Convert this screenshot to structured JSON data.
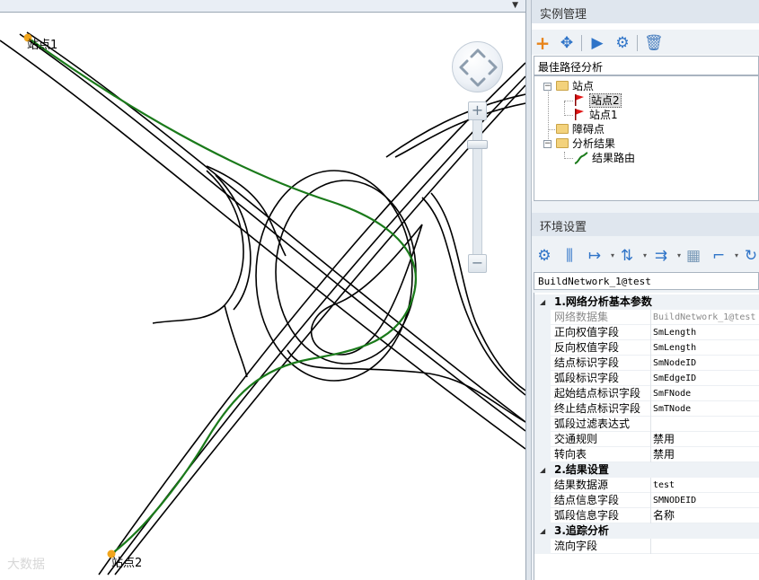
{
  "map": {
    "labels": {
      "station1": "站点1",
      "station2": "站点2"
    },
    "watermark": "大数据",
    "colors": {
      "road": "#000000",
      "route": "#1a7a1a",
      "station_marker": "#f0a51c"
    }
  },
  "instance_panel": {
    "title": "实例管理",
    "toolbar_icons": [
      "add-icon",
      "move-icon",
      "run-icon",
      "settings-icon",
      "delete-icon"
    ],
    "selected_instance": "最佳路径分析",
    "tree": {
      "stations": {
        "label": "站点",
        "children": [
          "站点2",
          "站点1"
        ]
      },
      "barriers": {
        "label": "障碍点"
      },
      "results": {
        "label": "分析结果",
        "children": [
          "结果路由"
        ]
      }
    }
  },
  "env_panel": {
    "title": "环境设置",
    "toolbar_icons": [
      "settings-icon",
      "network-icon",
      "direction-icon",
      "weight-icon",
      "flow-icon",
      "grid-icon",
      "trace-icon",
      "refresh-icon"
    ],
    "source": "BuildNetwork_1@test",
    "categories": [
      {
        "title": "1.网络分析基本参数",
        "rows": [
          {
            "name": "网络数据集",
            "value": "BuildNetwork_1@test"
          },
          {
            "name": "正向权值字段",
            "value": "SmLength"
          },
          {
            "name": "反向权值字段",
            "value": "SmLength"
          },
          {
            "name": "结点标识字段",
            "value": "SmNodeID"
          },
          {
            "name": "弧段标识字段",
            "value": "SmEdgeID"
          },
          {
            "name": "起始结点标识字段",
            "value": "SmFNode"
          },
          {
            "name": "终止结点标识字段",
            "value": "SmTNode"
          },
          {
            "name": "弧段过滤表达式",
            "value": ""
          },
          {
            "name": "交通规则",
            "value": "禁用"
          },
          {
            "name": "转向表",
            "value": "禁用"
          }
        ]
      },
      {
        "title": "2.结果设置",
        "rows": [
          {
            "name": "结果数据源",
            "value": "test"
          },
          {
            "name": "结点信息字段",
            "value": "SMNODEID"
          },
          {
            "name": "弧段信息字段",
            "value": "名称"
          }
        ]
      },
      {
        "title": "3.追踪分析",
        "rows": [
          {
            "name": "流向字段",
            "value": ""
          }
        ]
      }
    ]
  }
}
